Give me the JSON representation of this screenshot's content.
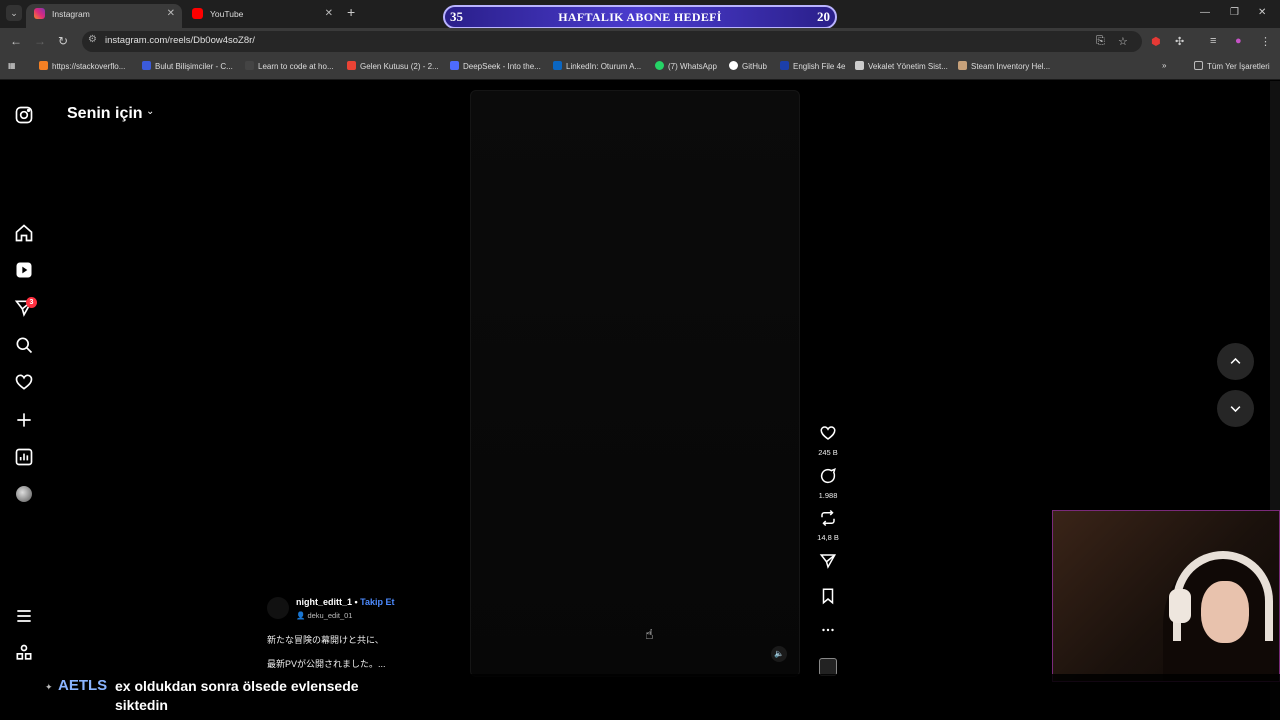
{
  "browser": {
    "tabs": [
      {
        "title": "Instagram",
        "active": true
      },
      {
        "title": "YouTube",
        "active": false
      }
    ],
    "url": "instagram.com/reels/Db0ow4soZ8r/",
    "bookmarks": [
      {
        "label": "https://stackoverflo...",
        "color": "#f48024"
      },
      {
        "label": "Bulut Bilişimciler - C...",
        "color": "#3b5bdb"
      },
      {
        "label": "Learn to code at ho...",
        "color": "#444444"
      },
      {
        "label": "Gelen Kutusu (2) - 2...",
        "color": "#ea4335"
      },
      {
        "label": "DeepSeek - Into the...",
        "color": "#4d6bfe"
      },
      {
        "label": "LinkedIn: Oturum A...",
        "color": "#0a66c2"
      },
      {
        "label": "(7) WhatsApp",
        "color": "#25d366"
      },
      {
        "label": "GitHub",
        "color": "#ffffff"
      },
      {
        "label": "English File 4e",
        "color": "#1c3faa"
      },
      {
        "label": "Vekalet Yönetim Sist...",
        "color": "#cccccc"
      },
      {
        "label": "Steam Inventory Hel...",
        "color": "#c7a17a"
      }
    ],
    "all_bookmarks": "Tüm Yer İşaretleri"
  },
  "stream_banner": {
    "left_number": "35",
    "title": "HAFTALIK ABONE HEDEFİ",
    "right_number": "20"
  },
  "sidebar": {
    "notification_count": "3"
  },
  "feed": {
    "title": "Senin için"
  },
  "reel": {
    "username": "night_editt_1",
    "separator": " • ",
    "follow_label": "Takip Et",
    "audio": "deku_edit_01",
    "caption_line1": "新たな冒険の幕開けと共に、",
    "caption_line2": "最新PVが公開されました。..."
  },
  "actions": {
    "likes": "245 B",
    "comments": "1.988",
    "reposts": "14,8 B"
  },
  "chat": {
    "user": "AETLS",
    "message": "ex oldukdan sonra ölsede evlensede siktedin"
  },
  "colors": {
    "accent": "#4d8bff",
    "badge": "#ff3040",
    "banner": "#4b3ccf"
  }
}
